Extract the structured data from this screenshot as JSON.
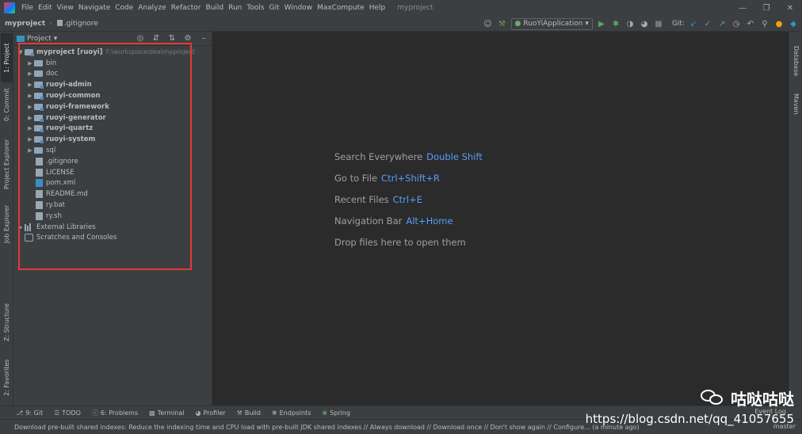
{
  "menubar": {
    "items": [
      "File",
      "Edit",
      "View",
      "Navigate",
      "Code",
      "Analyze",
      "Refactor",
      "Build",
      "Run",
      "Tools",
      "Git",
      "Window",
      "MaxCompute",
      "Help"
    ],
    "title": "myproject"
  },
  "navbar": {
    "project": "myproject",
    "file": ".gitignore",
    "run_config": "RuoYiApplication",
    "git_label": "Git:"
  },
  "left_tabs": [
    "1: Project",
    "0: Commit",
    "Project Explorer",
    "Job Explorer",
    "Z: Structure",
    "2: Favorites"
  ],
  "right_tabs": [
    "Database",
    "Maven"
  ],
  "project_panel": {
    "title": "Project",
    "root": {
      "name": "myproject [ruoyi]",
      "path": "F:\\workspaceidea\\myproject"
    },
    "items": [
      {
        "name": "bin",
        "type": "folder"
      },
      {
        "name": "doc",
        "type": "folder"
      },
      {
        "name": "ruoyi-admin",
        "type": "module"
      },
      {
        "name": "ruoyi-common",
        "type": "module"
      },
      {
        "name": "ruoyi-framework",
        "type": "module"
      },
      {
        "name": "ruoyi-generator",
        "type": "module"
      },
      {
        "name": "ruoyi-quartz",
        "type": "module"
      },
      {
        "name": "ruoyi-system",
        "type": "module"
      },
      {
        "name": "sql",
        "type": "folder"
      },
      {
        "name": ".gitignore",
        "type": "file"
      },
      {
        "name": "LICENSE",
        "type": "file"
      },
      {
        "name": "pom.xml",
        "type": "maven"
      },
      {
        "name": "README.md",
        "type": "file"
      },
      {
        "name": "ry.bat",
        "type": "file"
      },
      {
        "name": "ry.sh",
        "type": "file"
      }
    ],
    "external_libraries": "External Libraries",
    "scratches": "Scratches and Consoles"
  },
  "editor_hints": [
    {
      "label": "Search Everywhere",
      "key": "Double Shift"
    },
    {
      "label": "Go to File",
      "key": "Ctrl+Shift+R"
    },
    {
      "label": "Recent Files",
      "key": "Ctrl+E"
    },
    {
      "label": "Navigation Bar",
      "key": "Alt+Home"
    },
    {
      "label": "Drop files here to open them",
      "key": ""
    }
  ],
  "bottom_tools": [
    "9: Git",
    "TODO",
    "6: Problems",
    "Terminal",
    "Profiler",
    "Build",
    "Endpoints",
    "Spring"
  ],
  "event_log": "Event Log",
  "status": {
    "message": "Download pre-built shared indexes: Reduce the indexing time and CPU load with pre-built JDK shared indexes // Always download // Download once // Don't show again // Configure... (a minute ago)",
    "branch": "master"
  },
  "watermark": {
    "title": "咕哒咕哒",
    "url": "https://blog.csdn.net/qq_41057655"
  },
  "colors": {
    "highlight_box": "#e53a36",
    "shortcut": "#589df6",
    "background": "#2b2b2b",
    "panel": "#3c3f41"
  }
}
